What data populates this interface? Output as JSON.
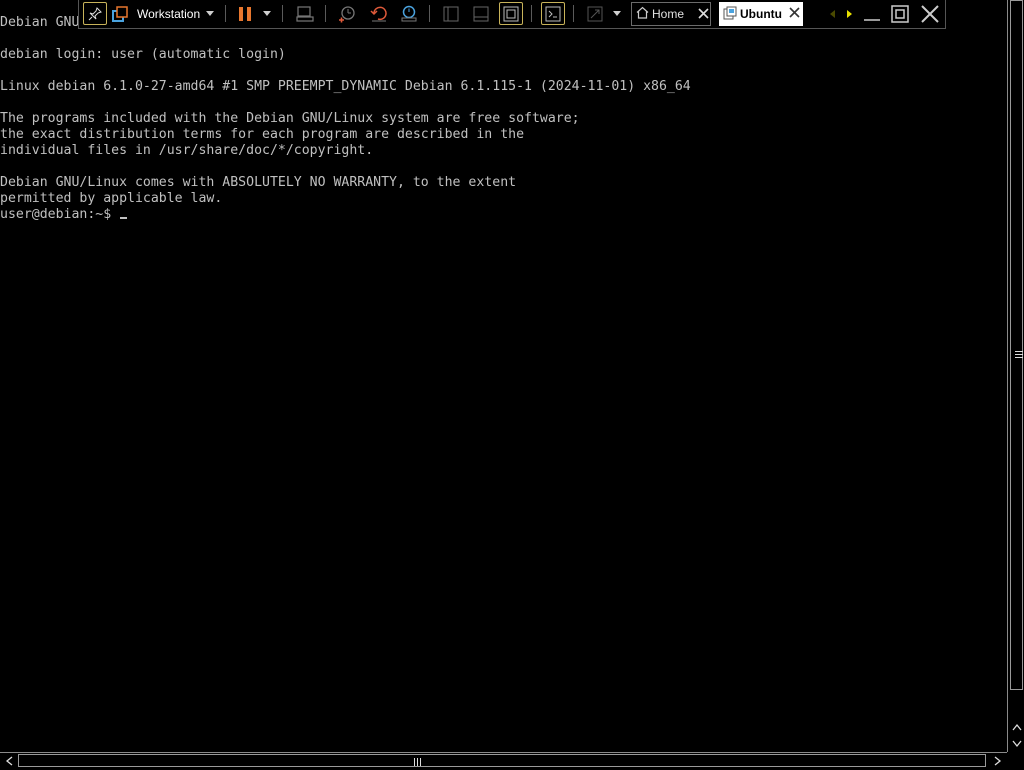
{
  "console": {
    "lines": [
      "Debian GNU",
      "",
      "debian login: user (automatic login)",
      "",
      "Linux debian 6.1.0-27-amd64 #1 SMP PREEMPT_DYNAMIC Debian 6.1.115-1 (2024-11-01) x86_64",
      "",
      "The programs included with the Debian GNU/Linux system are free software;",
      "the exact distribution terms for each program are described in the",
      "individual files in /usr/share/doc/*/copyright.",
      "",
      "Debian GNU/Linux comes with ABSOLUTELY NO WARRANTY, to the extent",
      "permitted by applicable law.",
      "user@debian:~$ "
    ]
  },
  "toolbar": {
    "library_menu_label": "Workstation",
    "tabs": [
      {
        "label": "Home",
        "icon": "home-icon",
        "active": false
      },
      {
        "label": "Ubuntu",
        "icon": "vm-icon",
        "active": true
      }
    ]
  },
  "colors": {
    "console_bg": "#000000",
    "console_text": "#c0c0c0",
    "pause_accent": "#e8772e",
    "icon_blue": "#4aa3df",
    "nav_yellow": "#e8e000"
  }
}
